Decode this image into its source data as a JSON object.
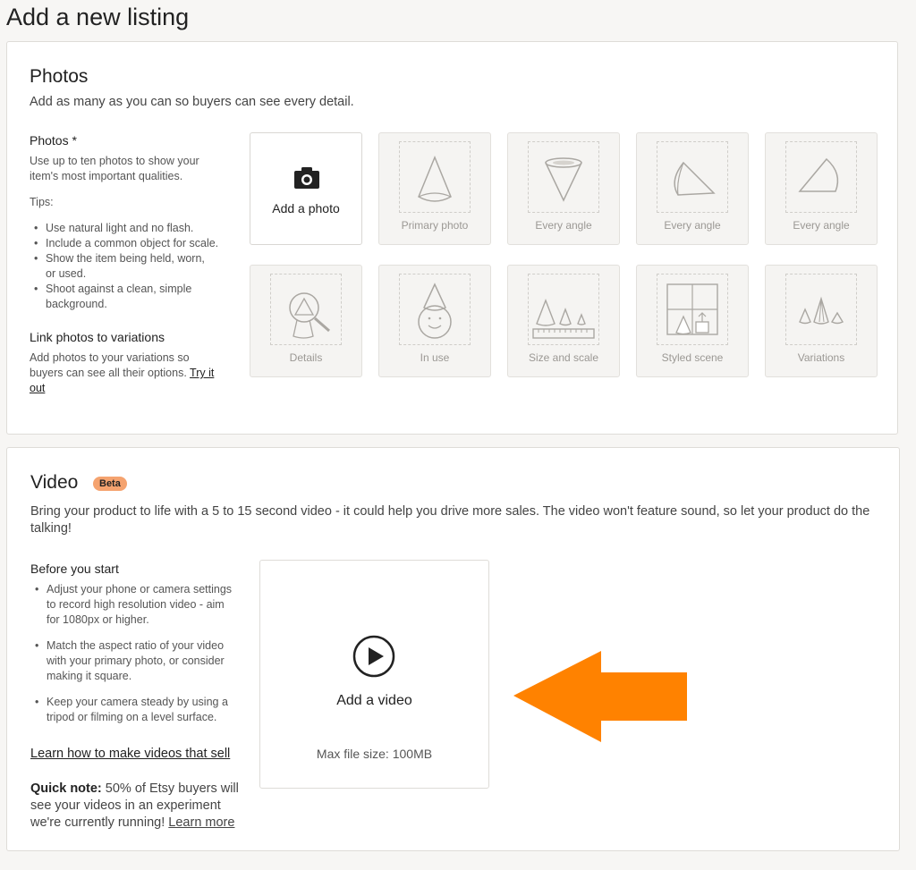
{
  "page": {
    "title": "Add a new listing"
  },
  "photos": {
    "title": "Photos",
    "description": "Add as many as you can so buyers can see every detail.",
    "sidebar": {
      "heading": "Photos *",
      "intro_line1": "Use up to ten photos to show your",
      "intro_line2": "item's most important qualities.",
      "tips_label": "Tips:",
      "tips": [
        [
          "Use natural light and no flash."
        ],
        [
          "Include a common object for scale."
        ],
        [
          "Show the item being held, worn,",
          "or used."
        ],
        [
          "Shoot against a clean, simple",
          "background."
        ]
      ],
      "link_heading": "Link photos to variations",
      "link_text_line1": "Add photos to your variations so",
      "link_text_line2": "buyers can see all their options.",
      "try_it_out": "Try it",
      "try_it_out_2": "out"
    },
    "add_label": "Add a photo",
    "tiles": [
      {
        "caption": "Primary photo",
        "icon": "cone-icon"
      },
      {
        "caption": "Every angle",
        "icon": "inverted-cone-icon"
      },
      {
        "caption": "Every angle",
        "icon": "tilted-cone-icon"
      },
      {
        "caption": "Every angle",
        "icon": "side-cone-icon"
      },
      {
        "caption": "Details",
        "icon": "magnifier-icon"
      },
      {
        "caption": "In use",
        "icon": "person-cone-hat-icon"
      },
      {
        "caption": "Size and scale",
        "icon": "ruler-cones-icon"
      },
      {
        "caption": "Styled scene",
        "icon": "window-scene-icon"
      },
      {
        "caption": "Variations",
        "icon": "three-cones-icon"
      }
    ]
  },
  "video": {
    "title": "Video",
    "badge": "Beta",
    "description_line1": "Bring your product to life with a 5 to 15 second video - it could help you drive more sales. The video won't feature sound, so let your product do the",
    "description_line2": "talking!",
    "before_heading": "Before you start",
    "tips": [
      [
        "Adjust your phone or camera settings",
        "to record high resolution video - aim",
        "for 1080px or higher."
      ],
      [
        "Match the aspect ratio of your video",
        "with your primary photo, or consider",
        "making it square."
      ],
      [
        "Keep your camera steady by using a",
        "tripod or filming on a level surface."
      ]
    ],
    "learn_link": "Learn how to make videos that sell",
    "quick_label": "Quick note:",
    "quick_text_1": " 50% of Etsy buyers will",
    "quick_text_2": "see your videos in an experiment",
    "quick_text_3": "we're currently running! ",
    "learn_more": "Learn more",
    "add_label": "Add a video",
    "max_size": "Max file size: 100MB",
    "arrow_color": "#ff8200"
  }
}
